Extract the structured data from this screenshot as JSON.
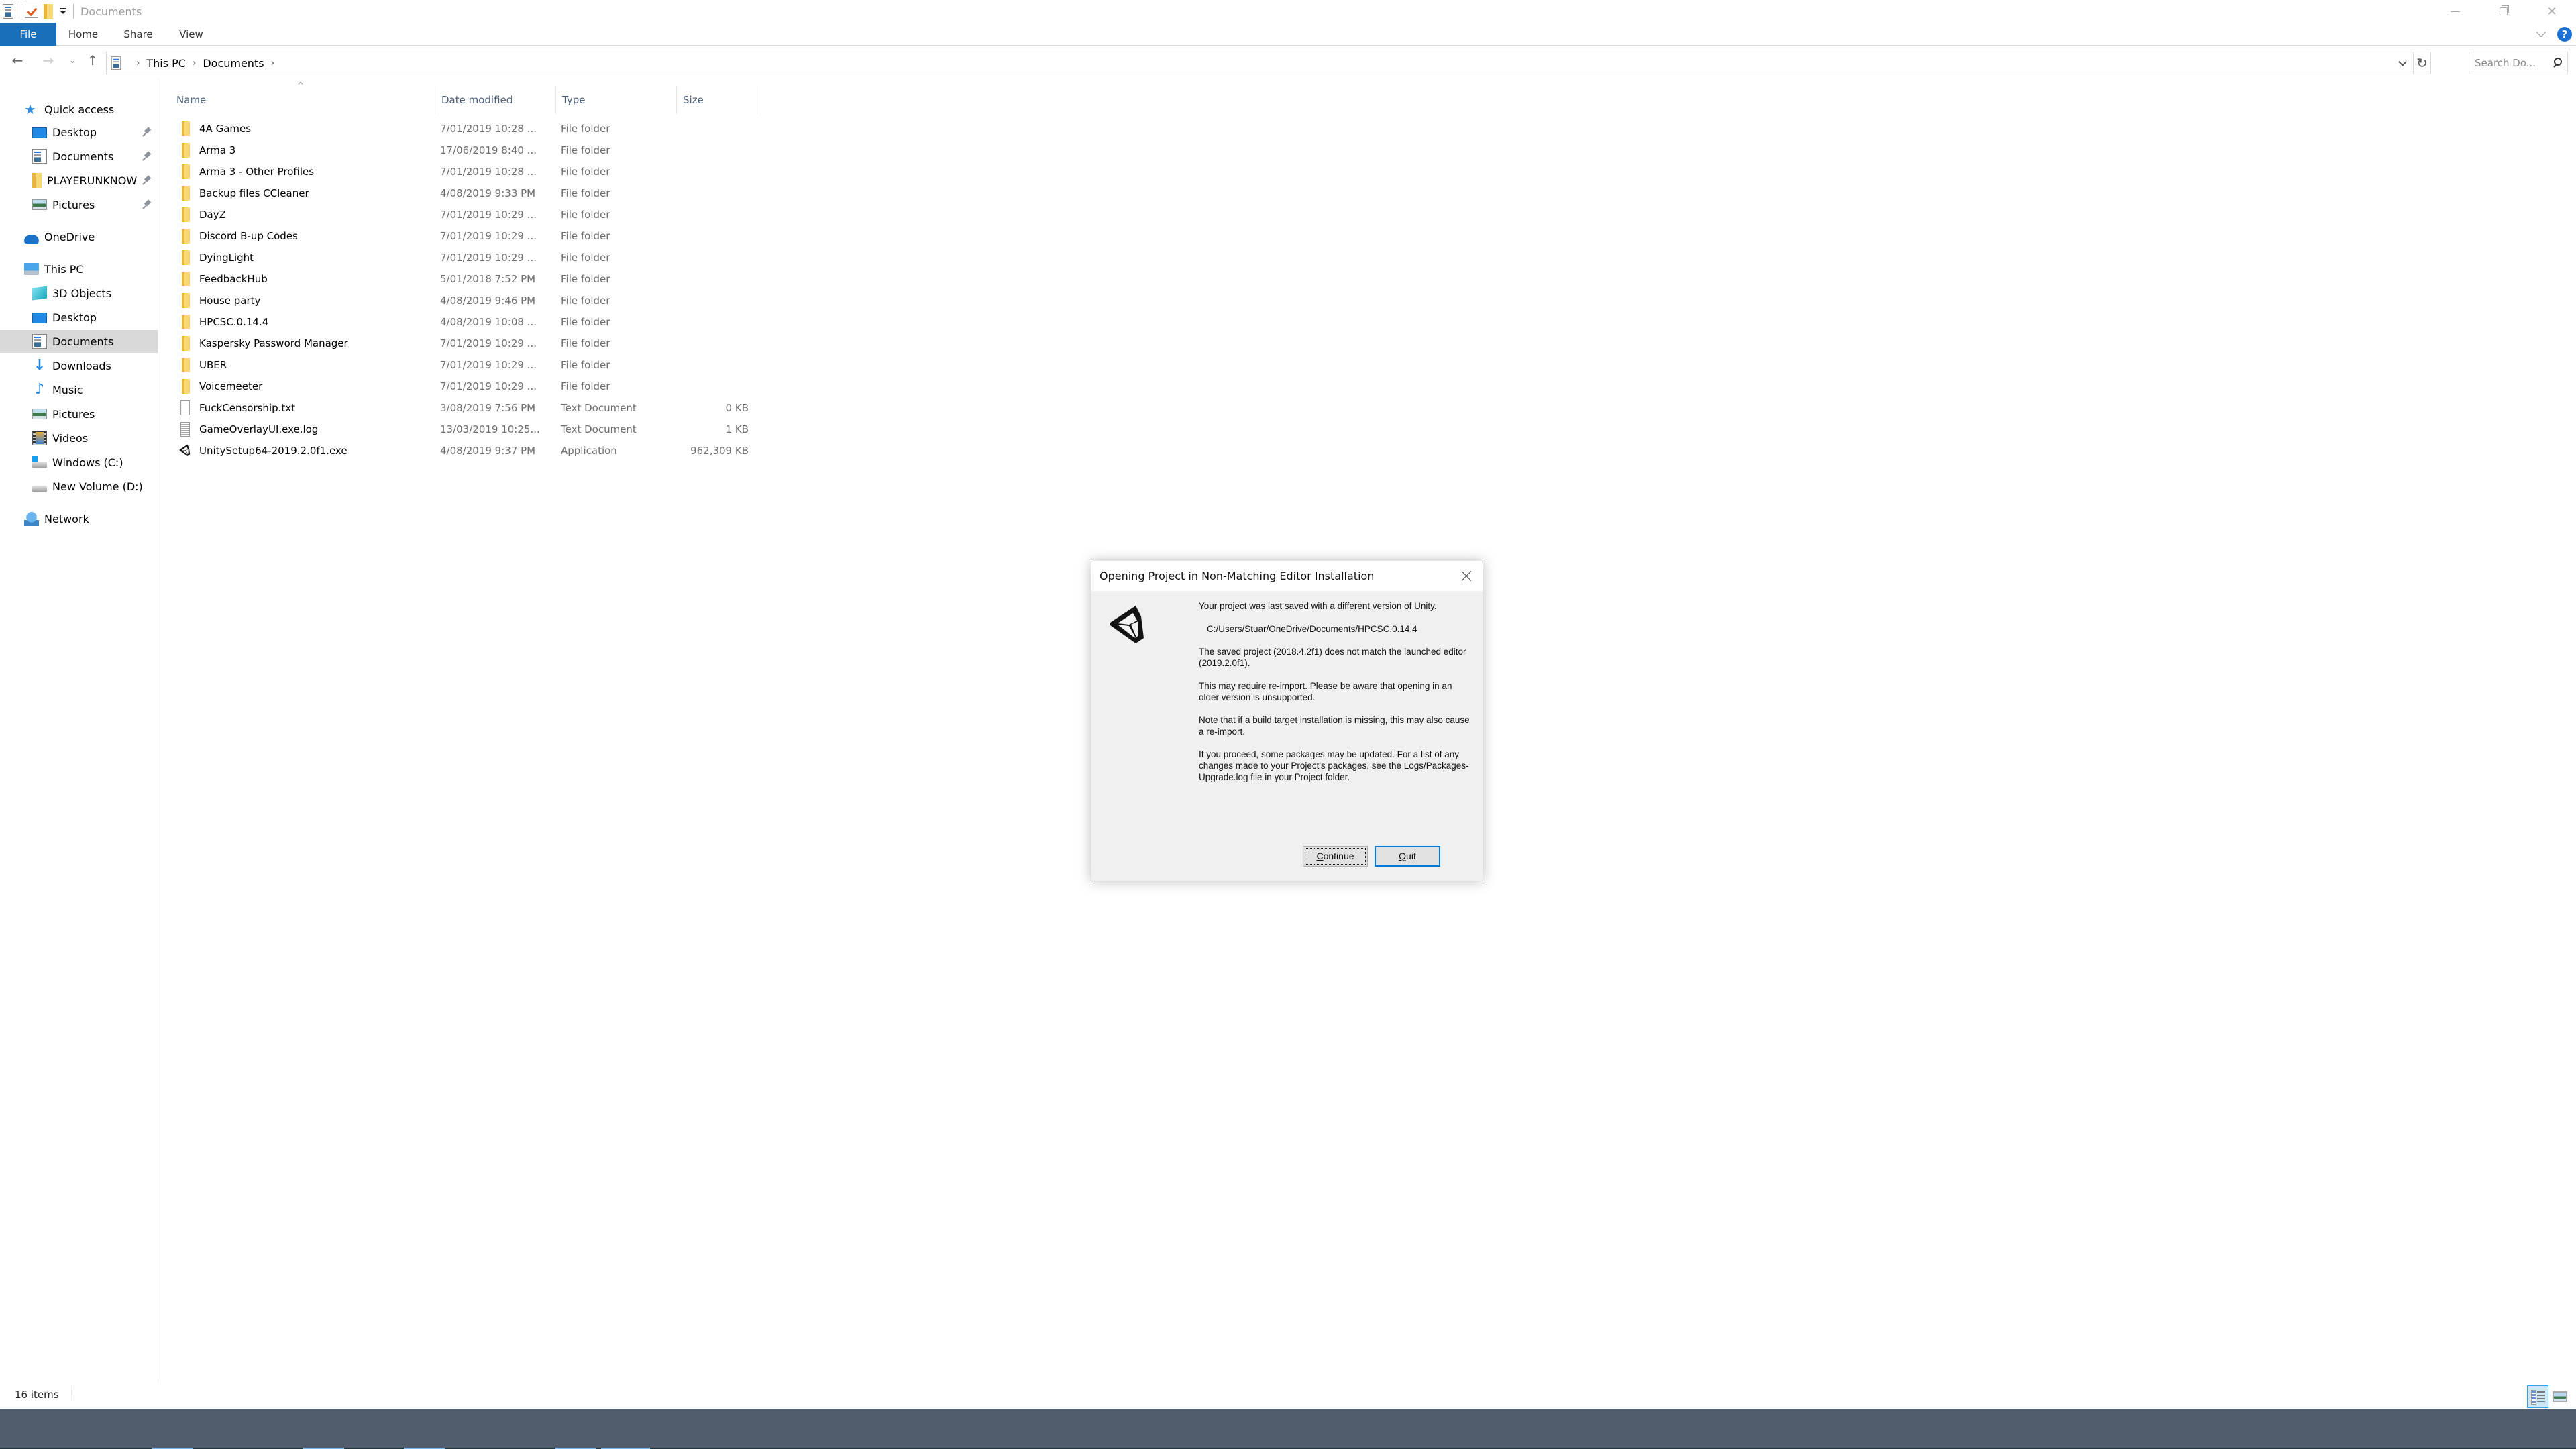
{
  "window": {
    "title": "Documents",
    "controls": {
      "minimize": "minimize",
      "maximize": "restore",
      "close": "close"
    }
  },
  "ribbon": {
    "tabs": [
      {
        "label": "File",
        "active": true
      },
      {
        "label": "Home"
      },
      {
        "label": "Share"
      },
      {
        "label": "View"
      }
    ],
    "help": "?"
  },
  "address": {
    "breadcrumb": [
      "This PC",
      "Documents"
    ],
    "search_placeholder": "Search Do..."
  },
  "nav_pane": {
    "items": [
      {
        "label": "Quick access",
        "icon": "quick-access-star-icon",
        "level": 1
      },
      {
        "label": "Desktop",
        "icon": "desktop-icon",
        "level": 2,
        "pinned": true
      },
      {
        "label": "Documents",
        "icon": "documents-icon",
        "level": 2,
        "pinned": true
      },
      {
        "label": "PLAYERUNKNOWN'S BATTLEGROUNDS",
        "icon": "folder-icon",
        "level": 2,
        "pinned": true
      },
      {
        "label": "Pictures",
        "icon": "pictures-icon",
        "level": 2,
        "pinned": true
      },
      {
        "label": "OneDrive",
        "icon": "onedrive-cloud-icon",
        "level": 1
      },
      {
        "label": "This PC",
        "icon": "this-pc-icon",
        "level": 1
      },
      {
        "label": "3D Objects",
        "icon": "3d-objects-icon",
        "level": 2
      },
      {
        "label": "Desktop",
        "icon": "desktop-icon",
        "level": 2
      },
      {
        "label": "Documents",
        "icon": "documents-icon",
        "level": 2,
        "selected": true
      },
      {
        "label": "Downloads",
        "icon": "downloads-arrow-icon",
        "level": 2
      },
      {
        "label": "Music",
        "icon": "music-note-icon",
        "level": 2
      },
      {
        "label": "Pictures",
        "icon": "pictures-icon",
        "level": 2
      },
      {
        "label": "Videos",
        "icon": "videos-icon",
        "level": 2
      },
      {
        "label": "Windows (C:)",
        "icon": "windows-drive-icon",
        "level": 2
      },
      {
        "label": "New Volume (D:)",
        "icon": "drive-icon",
        "level": 2
      },
      {
        "label": "Network",
        "icon": "network-icon",
        "level": 1
      }
    ]
  },
  "file_list": {
    "columns": {
      "name": "Name",
      "date": "Date modified",
      "type": "Type",
      "size": "Size"
    },
    "sorted_by": "Name",
    "rows": [
      {
        "name": "4A Games",
        "date": "7/01/2019 10:28 ...",
        "type": "File folder",
        "size": "",
        "icon": "folder"
      },
      {
        "name": "Arma 3",
        "date": "17/06/2019 8:40 ...",
        "type": "File folder",
        "size": "",
        "icon": "folder"
      },
      {
        "name": "Arma 3 - Other Profiles",
        "date": "7/01/2019 10:28 ...",
        "type": "File folder",
        "size": "",
        "icon": "folder"
      },
      {
        "name": "Backup files CCleaner",
        "date": "4/08/2019 9:33 PM",
        "type": "File folder",
        "size": "",
        "icon": "folder"
      },
      {
        "name": "DayZ",
        "date": "7/01/2019 10:29 ...",
        "type": "File folder",
        "size": "",
        "icon": "folder"
      },
      {
        "name": "Discord B-up Codes",
        "date": "7/01/2019 10:29 ...",
        "type": "File folder",
        "size": "",
        "icon": "folder"
      },
      {
        "name": "DyingLight",
        "date": "7/01/2019 10:29 ...",
        "type": "File folder",
        "size": "",
        "icon": "folder"
      },
      {
        "name": "FeedbackHub",
        "date": "5/01/2018 7:52 PM",
        "type": "File folder",
        "size": "",
        "icon": "folder"
      },
      {
        "name": "House party",
        "date": "4/08/2019 9:46 PM",
        "type": "File folder",
        "size": "",
        "icon": "folder"
      },
      {
        "name": "HPCSC.0.14.4",
        "date": "4/08/2019 10:08 ...",
        "type": "File folder",
        "size": "",
        "icon": "folder"
      },
      {
        "name": "Kaspersky Password Manager",
        "date": "7/01/2019 10:29 ...",
        "type": "File folder",
        "size": "",
        "icon": "folder"
      },
      {
        "name": "UBER",
        "date": "7/01/2019 10:29 ...",
        "type": "File folder",
        "size": "",
        "icon": "folder"
      },
      {
        "name": "Voicemeeter",
        "date": "7/01/2019 10:29 ...",
        "type": "File folder",
        "size": "",
        "icon": "folder"
      },
      {
        "name": "FuckCensorship.txt",
        "date": "3/08/2019 7:56 PM",
        "type": "Text Document",
        "size": "0 KB",
        "icon": "text"
      },
      {
        "name": "GameOverlayUI.exe.log",
        "date": "13/03/2019 10:25...",
        "type": "Text Document",
        "size": "1 KB",
        "icon": "text"
      },
      {
        "name": "UnitySetup64-2019.2.0f1.exe",
        "date": "4/08/2019 9:37 PM",
        "type": "Application",
        "size": "962,309 KB",
        "icon": "unity"
      }
    ]
  },
  "status_bar": {
    "item_count": "16 items"
  },
  "dialog": {
    "title": "Opening Project in Non-Matching Editor Installation",
    "paragraphs": [
      "Your project was last saved with a different version of Unity.",
      "C:/Users/Stuar/OneDrive/Documents/HPCSC.0.14.4",
      "The saved project (2018.4.2f1) does not match the launched editor (2019.2.0f1).",
      "This may require re-import. Please be aware that opening in an older version is unsupported.",
      "Note that if a build target installation is missing, this may also cause a re-import.",
      "If you proceed, some packages may be updated. For a list of any changes made to your Project's packages, see the Logs/Packages-Upgrade.log file in your Project folder."
    ],
    "buttons": {
      "continue": {
        "accel": "C",
        "rest": "ontinue"
      },
      "quit": {
        "accel": "Q",
        "rest": "uit"
      }
    }
  },
  "colors": {
    "file_tab": "#1a6fba",
    "selected_nav": "#d9d9d9",
    "taskbar": "#515d6d",
    "default_button_border": "#0078d7"
  }
}
